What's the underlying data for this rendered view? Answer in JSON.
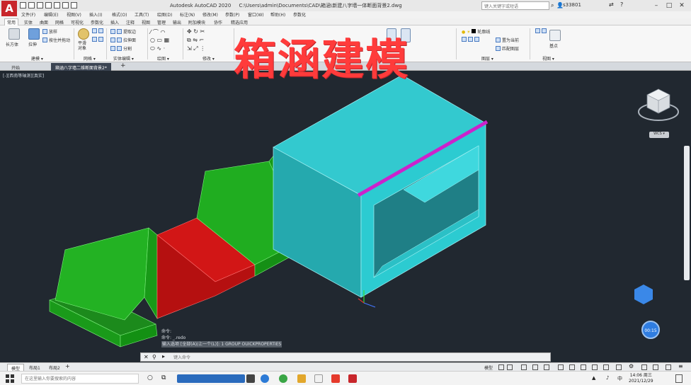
{
  "window": {
    "app_title": "Autodesk AutoCAD 2020",
    "file_path": "C:\\Users\\admin\\Documents\\CAD\\箱涵\\新建八字墙一体断面背景2.dwg",
    "search_placeholder": "键入关键字或短语",
    "user": "s33801",
    "logo_letter": "A"
  },
  "menu": [
    "文件(F)",
    "编辑(E)",
    "视图(V)",
    "插入(I)",
    "格式(O)",
    "工具(T)",
    "绘图(D)",
    "标注(N)",
    "修改(M)",
    "参数(P)",
    "窗口(W)",
    "帮助(H)",
    "参数化"
  ],
  "ribbon_tabs": [
    "常用",
    "实体",
    "曲面",
    "网格",
    "可视化",
    "参数化",
    "插入",
    "注释",
    "视图",
    "管理",
    "输出",
    "附加模块",
    "协作",
    "精选应用"
  ],
  "ribbon": {
    "groups": {
      "modeling": "建模 ▾",
      "mesh": "网格 ▾",
      "solid_edit": "实体编辑 ▾",
      "draw": "绘图 ▾",
      "modify": "修改 ▾",
      "layers": "图层 ▾",
      "view": "视图 ▾"
    },
    "buttons": {
      "box": "长方体",
      "extrude": "拉伸",
      "smooth_object": "平滑\n对象",
      "loft": "放样",
      "presspull": "按住并拖动",
      "extract_edges": "提取边",
      "extrude_faces": "拉伸面",
      "separate": "分割",
      "layer_name": "轮廓线",
      "current_layer": "置为当前",
      "match_layer": "匹配图层",
      "base": "基点"
    }
  },
  "doc_tabs": [
    "开始",
    "箱涵八字墙二维断面背景2*"
  ],
  "viewport": {
    "view_label": "[-][西南等轴测][真实]",
    "overlay_title": "箱涵建模",
    "wcs": "WCS ▾",
    "timer": "00:15"
  },
  "command": {
    "history": [
      "命令:",
      "命令: _.redo",
      "输入选项 [全部(A)/上一个(L)]: 1 GROUP OUICKPROPERTIES"
    ],
    "placeholder": "键入命令"
  },
  "layout_tabs": [
    "模型",
    "布局1",
    "布局2"
  ],
  "status": {
    "model": "模型"
  },
  "taskbar": {
    "search_placeholder": "在这里输入你要搜索的内容",
    "time": "14:06 周三",
    "date": "2021/12/29"
  },
  "colors": {
    "viewport_bg": "#212830",
    "box_culvert": "#29c2c9",
    "wing_walls": "#22b122",
    "floor_slab": "#d71b1b",
    "highlight_edge": "#cc22cc",
    "overlay_text": "#ff3b3b"
  }
}
